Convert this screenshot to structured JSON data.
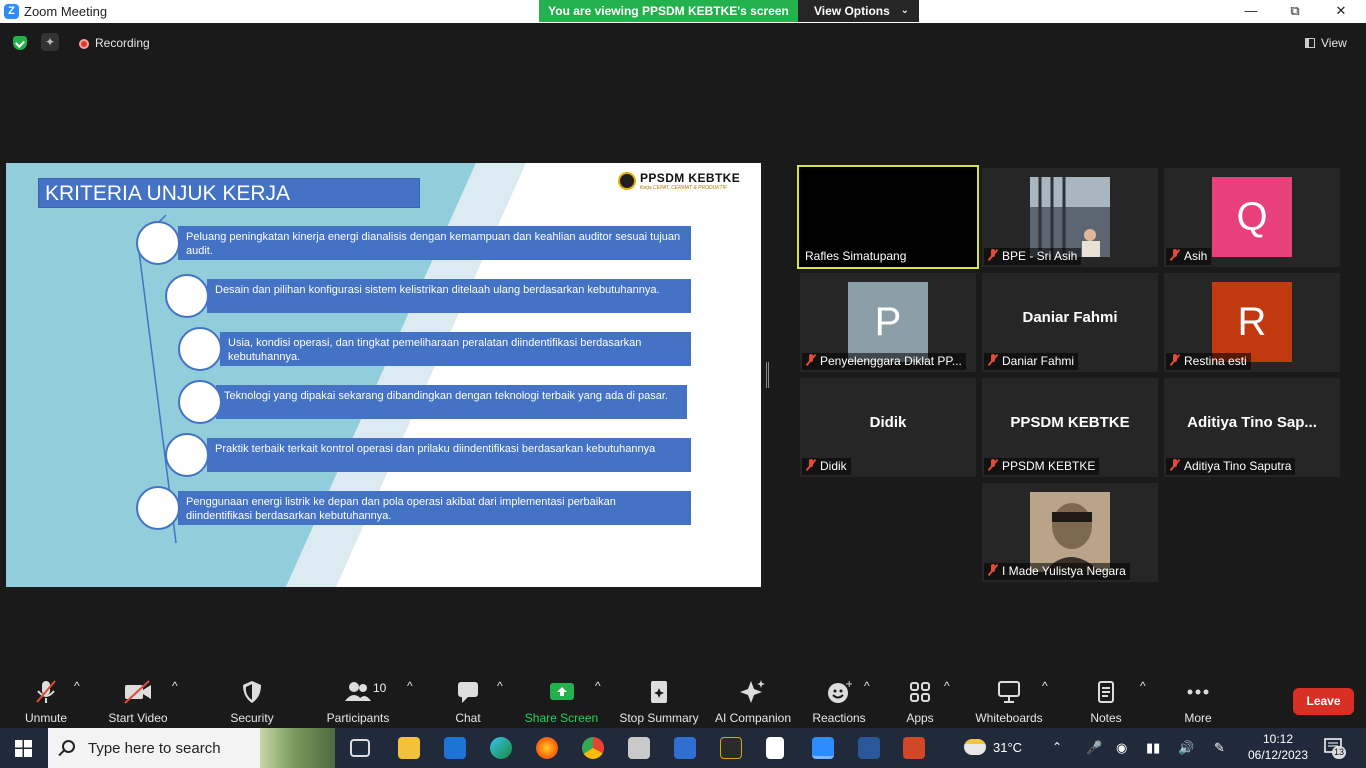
{
  "window": {
    "title": "Zoom Meeting",
    "viewing_banner": "You are viewing PPSDM KEBTKE's screen",
    "view_options_label": "View Options",
    "minimize_glyph": "—",
    "maximize_glyph": "⧉",
    "close_glyph": "✕"
  },
  "status": {
    "recording_label": "Recording",
    "view_label": "View"
  },
  "slide": {
    "title": "KRITERIA UNJUK KERJA",
    "brand_name": "PPSDM KEBTKE",
    "brand_tagline": "Kerja CEPAT, CERMAT & PRODUKTIF",
    "criteria": [
      "Peluang peningkatan kinerja energi dianalisis dengan kemampuan dan keahlian auditor sesuai tujuan audit.",
      "Desain dan pilihan konfigurasi sistem kelistrikan ditelaah ulang berdasarkan kebutuhannya.",
      "Usia, kondisi operasi, dan tingkat pemeliharaan peralatan diindentifikasi berdasarkan kebutuhannya.",
      "Teknologi yang dipakai sekarang dibandingkan dengan teknologi terbaik yang ada di pasar.",
      "Praktik terbaik terkait kontrol operasi dan prilaku diindentifikasi berdasarkan kebutuhannya",
      "Penggunaan energi listrik ke depan dan pola operasi akibat dari implementasi perbaikan diindentifikasi berdasarkan kebutuhannya."
    ]
  },
  "participants": [
    {
      "name": "Rafles Simatupang",
      "muted": false
    },
    {
      "name": "BPE - Sri Asih",
      "muted": true
    },
    {
      "name": "Asih",
      "muted": true,
      "avatar_letter": "Q",
      "avatar_color": "#e8407a"
    },
    {
      "name": "Penyelenggara Diklat PP...",
      "muted": true,
      "avatar_letter": "P",
      "avatar_color": "#8c9fa8"
    },
    {
      "name": "Daniar Fahmi",
      "muted": true,
      "display": "Daniar Fahmi"
    },
    {
      "name": "Restina esti",
      "muted": true,
      "avatar_letter": "R",
      "avatar_color": "#c0390f"
    },
    {
      "name": "Didik",
      "muted": true,
      "display": "Didik"
    },
    {
      "name": "PPSDM KEBTKE",
      "muted": true,
      "display": "PPSDM KEBTKE"
    },
    {
      "name": "Aditiya Tino Saputra",
      "muted": true,
      "display": "Aditiya Tino Sap..."
    },
    {
      "name": "I Made Yulistya Negara",
      "muted": true
    }
  ],
  "toolbar": {
    "unmute": "Unmute",
    "start_video": "Start Video",
    "security": "Security",
    "participants": "Participants",
    "participants_count": "10",
    "chat": "Chat",
    "share_screen": "Share Screen",
    "stop_summary": "Stop Summary",
    "ai_companion": "AI Companion",
    "reactions": "Reactions",
    "apps": "Apps",
    "whiteboards": "Whiteboards",
    "notes": "Notes",
    "more": "More",
    "leave": "Leave",
    "caret": "^"
  },
  "taskbar": {
    "search_placeholder": "Type here to search",
    "weather": "31°C",
    "time": "10:12",
    "date": "06/12/2023",
    "notification_count": "13"
  },
  "colors": {
    "accent_green": "#23b14d",
    "slide_blue": "#4472c4",
    "slide_cyan": "#92cddc",
    "leave_red": "#d93025",
    "active_speaker": "#d7e34a"
  }
}
